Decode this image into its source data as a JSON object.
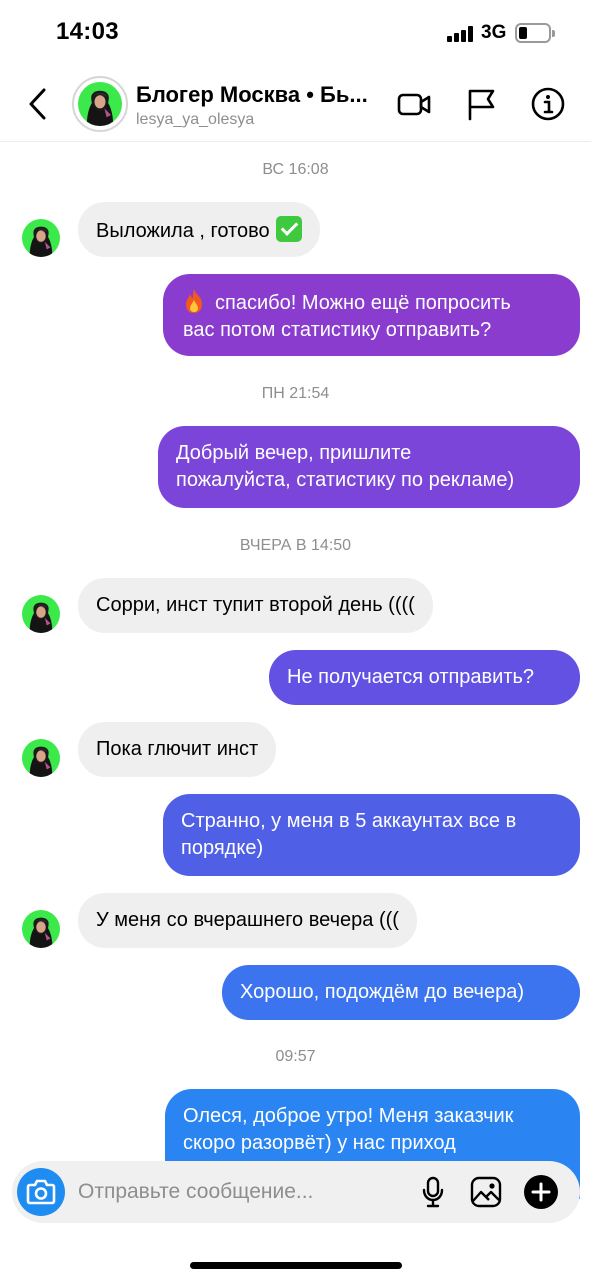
{
  "status_bar": {
    "time": "14:03",
    "network": "3G",
    "battery_level_percent": 20
  },
  "header": {
    "back_icon": "chevron-left-icon",
    "title": "Блогер Москва • Бь...",
    "username": "lesya_ya_olesya",
    "video_call_icon": "video-camera-icon",
    "report_icon": "flag-icon",
    "info_icon": "info-icon"
  },
  "timestamps": [
    "ВС 16:08",
    "ПН 21:54",
    "ВЧЕРА В 14:50",
    "09:57"
  ],
  "messages": [
    {
      "sender": "contact",
      "text": "Выложила , готово",
      "emoji": "check-mark-icon"
    },
    {
      "sender": "me",
      "emoji": "fire-icon",
      "lines": [
        "спасибо! Можно ещё попросить",
        "вас потом статистику отправить?"
      ]
    },
    {
      "sender": "me",
      "lines": [
        "Добрый вечер, пришлите",
        "пожалуйста, статистику по рекламе)"
      ]
    },
    {
      "sender": "contact",
      "text": "Сорри, инст тупит второй день (((("
    },
    {
      "sender": "me",
      "lines": [
        "Не получается отправить?"
      ]
    },
    {
      "sender": "contact",
      "text": "Пока глючит инст"
    },
    {
      "sender": "me",
      "lines": [
        "Странно, у меня в 5 аккаунтах все в",
        "порядке)"
      ]
    },
    {
      "sender": "contact",
      "text": "У меня со вчерашнего вечера ((("
    },
    {
      "sender": "me",
      "lines": [
        "Хорошо, подождём до вечера)"
      ]
    },
    {
      "sender": "me",
      "lines": [
        "Олеся, доброе утро! Меня заказчик",
        "скоро разорвёт) у нас приход"
      ]
    }
  ],
  "composer": {
    "placeholder": "Отправьте сообщение...",
    "camera_icon": "camera-icon",
    "mic_icon": "microphone-icon",
    "gallery_icon": "image-icon",
    "plus_icon": "plus-icon"
  },
  "colors": {
    "outgoing_gradient": [
      "#8a3ccf",
      "#7b45da",
      "#6251e2",
      "#4f5fe6",
      "#3b74ee",
      "#2a85f2"
    ],
    "incoming_bubble": "#efefef",
    "accent_blue": "#1f8cf2",
    "secondary_text": "#8e8e8e"
  }
}
